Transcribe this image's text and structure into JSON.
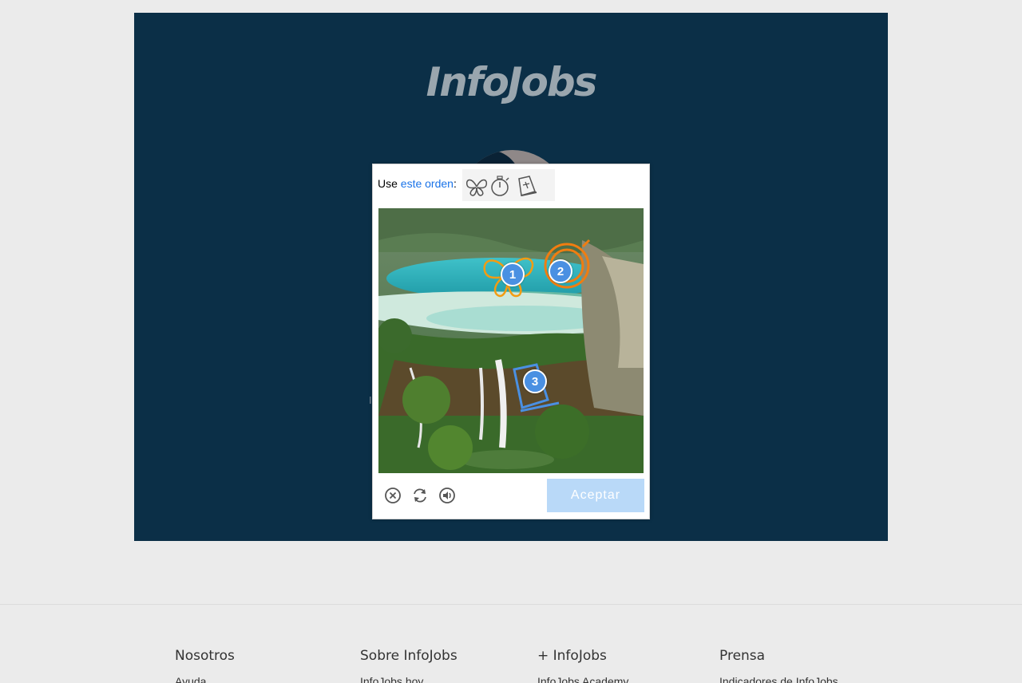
{
  "brand": {
    "logo_text": "InfoJobs"
  },
  "page": {
    "hint_left": "I",
    "hint_right": "."
  },
  "captcha": {
    "prompt_prefix": "Use",
    "prompt_link": "este orden",
    "prompt_colon": ":",
    "order": [
      "butterfly-icon",
      "stopwatch-icon",
      "bell-icon"
    ],
    "markers": [
      "1",
      "2",
      "3"
    ],
    "accept_label": "Aceptar",
    "tools": [
      "close-icon",
      "refresh-icon",
      "audio-icon"
    ],
    "colors": {
      "accent": "#4a90e2",
      "button": "#b9d9f8",
      "link": "#1a73e8"
    }
  },
  "footer": {
    "columns": [
      {
        "title": "Nosotros",
        "links": [
          "Ayuda"
        ]
      },
      {
        "title": "Sobre InfoJobs",
        "links": [
          "InfoJobs hoy"
        ]
      },
      {
        "title": "+ InfoJobs",
        "links": [
          "InfoJobs Academy"
        ]
      },
      {
        "title": "Prensa",
        "links": [
          "Indicadores de InfoJobs"
        ]
      }
    ]
  },
  "colors": {
    "hero_bg": "#0b2f47",
    "page_bg": "#ebebeb"
  }
}
